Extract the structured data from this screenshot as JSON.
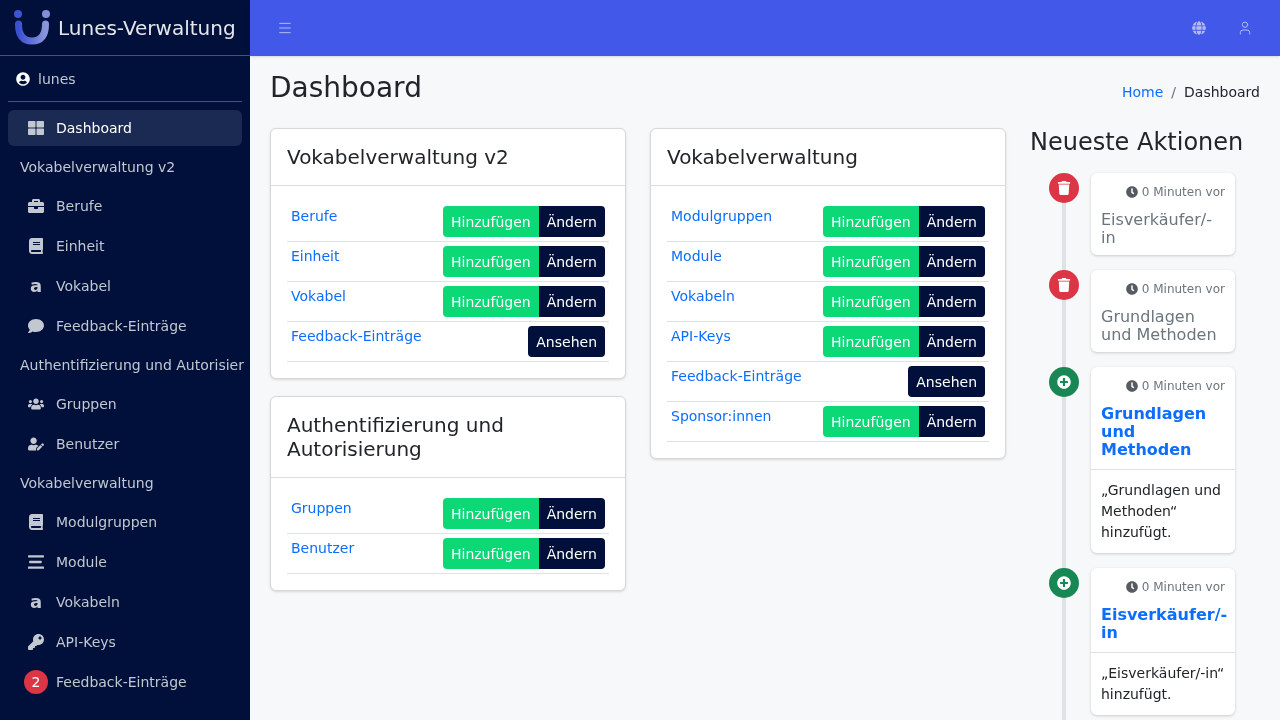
{
  "brand": {
    "name": "Lunes-Verwaltung"
  },
  "sidebar": {
    "user": "lunes",
    "groups": [
      {
        "items": [
          {
            "label": "Dashboard",
            "selected": true
          }
        ]
      },
      {
        "title": "Vokabelverwaltung v2",
        "items": [
          {
            "label": "Berufe",
            "selected": false
          },
          {
            "label": "Einheit",
            "selected": false
          },
          {
            "label": "Vokabel",
            "glyph": "a",
            "selected": false
          },
          {
            "label": "Feedback-Einträge",
            "selected": false
          }
        ]
      },
      {
        "title": "Authentifizierung und Autorisier",
        "items": [
          {
            "label": "Gruppen",
            "selected": false
          },
          {
            "label": "Benutzer",
            "selected": false
          }
        ]
      },
      {
        "title": "Vokabelverwaltung",
        "items": [
          {
            "label": "Modulgruppen",
            "selected": false
          },
          {
            "label": "Module",
            "selected": false
          },
          {
            "label": "Vokabeln",
            "glyph": "a",
            "selected": false
          },
          {
            "label": "API-Keys",
            "selected": false
          },
          {
            "label": "Feedback-Einträge",
            "badge": "2",
            "selected": false
          }
        ]
      }
    ]
  },
  "page": {
    "title": "Dashboard",
    "breadcrumb_separator": "/",
    "breadcrumb": [
      {
        "label": "Home",
        "active": false
      },
      {
        "label": "Dashboard",
        "active": true
      }
    ]
  },
  "columns": [
    {
      "cards": [
        {
          "title": "Vokabelverwaltung v2",
          "rows": [
            {
              "label": "Berufe",
              "actions": [
                {
                  "kind": "add",
                  "label": "Hinzufügen"
                },
                {
                  "kind": "change",
                  "label": "Ändern"
                }
              ]
            },
            {
              "label": "Einheit",
              "actions": [
                {
                  "kind": "add",
                  "label": "Hinzufügen"
                },
                {
                  "kind": "change",
                  "label": "Ändern"
                }
              ]
            },
            {
              "label": "Vokabel",
              "actions": [
                {
                  "kind": "add",
                  "label": "Hinzufügen"
                },
                {
                  "kind": "change",
                  "label": "Ändern"
                }
              ]
            },
            {
              "label": "Feedback-Einträge",
              "actions": [
                {
                  "kind": "view",
                  "label": "Ansehen"
                }
              ]
            }
          ]
        },
        {
          "title": "Authentifizierung und Autorisierung",
          "rows": [
            {
              "label": "Gruppen",
              "actions": [
                {
                  "kind": "add",
                  "label": "Hinzufügen"
                },
                {
                  "kind": "change",
                  "label": "Ändern"
                }
              ]
            },
            {
              "label": "Benutzer",
              "actions": [
                {
                  "kind": "add",
                  "label": "Hinzufügen"
                },
                {
                  "kind": "change",
                  "label": "Ändern"
                }
              ]
            }
          ]
        }
      ]
    },
    {
      "cards": [
        {
          "title": "Vokabelverwaltung",
          "rows": [
            {
              "label": "Modulgruppen",
              "actions": [
                {
                  "kind": "add",
                  "label": "Hinzufügen"
                },
                {
                  "kind": "change",
                  "label": "Ändern"
                }
              ]
            },
            {
              "label": "Module",
              "actions": [
                {
                  "kind": "add",
                  "label": "Hinzufügen"
                },
                {
                  "kind": "change",
                  "label": "Ändern"
                }
              ]
            },
            {
              "label": "Vokabeln",
              "actions": [
                {
                  "kind": "add",
                  "label": "Hinzufügen"
                },
                {
                  "kind": "change",
                  "label": "Ändern"
                }
              ]
            },
            {
              "label": "API-Keys",
              "actions": [
                {
                  "kind": "add",
                  "label": "Hinzufügen"
                },
                {
                  "kind": "change",
                  "label": "Ändern"
                }
              ]
            },
            {
              "label": "Feedback-Einträge",
              "actions": [
                {
                  "kind": "view",
                  "label": "Ansehen"
                }
              ]
            },
            {
              "label": "Sponsor:innen",
              "actions": [
                {
                  "kind": "add",
                  "label": "Hinzufügen"
                },
                {
                  "kind": "change",
                  "label": "Ändern"
                }
              ]
            }
          ]
        }
      ]
    }
  ],
  "timeline": {
    "title": "Neueste Aktionen",
    "items": [
      {
        "kind": "deleted",
        "time": "0 Minuten vor",
        "title": "Eisverkäufer/-in"
      },
      {
        "kind": "deleted",
        "time": "0 Minuten vor",
        "title": "Grundlagen und Methoden"
      },
      {
        "kind": "added",
        "time": "0 Minuten vor",
        "title": "Grundlagen und Methoden",
        "body": "„Grundlagen und Methoden“ hinzufügt."
      },
      {
        "kind": "added",
        "time": "0 Minuten vor",
        "title": "Eisverkäufer/-in",
        "body": "„Eisverkäufer/-in“ hinzufügt."
      }
    ]
  }
}
